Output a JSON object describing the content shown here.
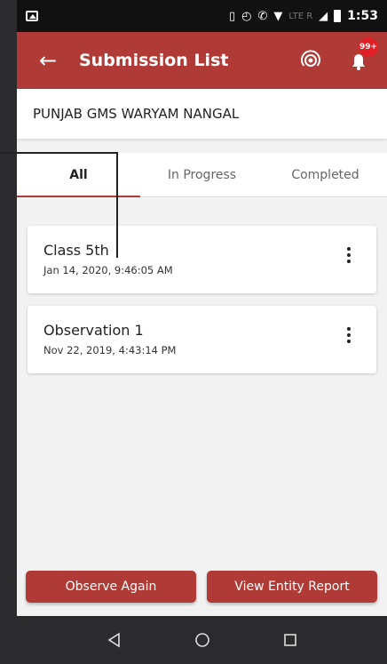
{
  "statusbar": {
    "time": "1:53",
    "network": "LTE",
    "network2": "LTE R"
  },
  "appbar": {
    "title": "Submission List",
    "badge": "99+"
  },
  "entity": {
    "name": "PUNJAB GMS WARYAM NANGAL"
  },
  "tabs": [
    {
      "label": "All",
      "active": true
    },
    {
      "label": "In Progress",
      "active": false
    },
    {
      "label": "Completed",
      "active": false
    }
  ],
  "submissions": [
    {
      "title": "Class 5th",
      "date": "Jan 14, 2020, 9:46:05 AM"
    },
    {
      "title": "Observation 1",
      "date": "Nov 22, 2019, 4:43:14 PM"
    }
  ],
  "actions": {
    "observe_again": "Observe Again",
    "view_report": "View Entity Report"
  },
  "colors": {
    "primary": "#b03a35",
    "badge": "#e01f26"
  },
  "icons": [
    "back-arrow-icon",
    "signal-icon",
    "bell-icon",
    "more-vert-icon",
    "nav-back-icon",
    "nav-home-icon",
    "nav-recents-icon"
  ]
}
